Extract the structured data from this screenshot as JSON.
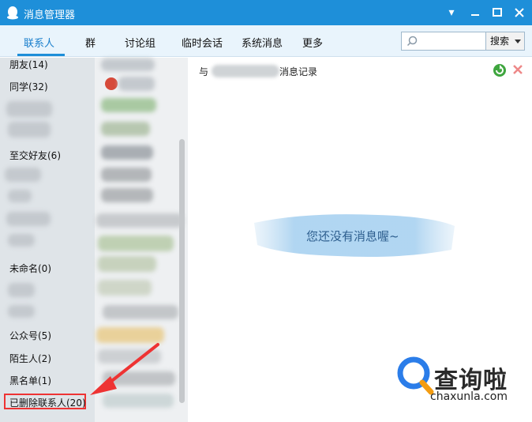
{
  "window": {
    "title": "消息管理器"
  },
  "tabs": [
    {
      "label": "联系人",
      "active": true
    },
    {
      "label": "群"
    },
    {
      "label": "讨论组"
    },
    {
      "label": "临时会话"
    },
    {
      "label": "系统消息"
    },
    {
      "label": "更多"
    }
  ],
  "search": {
    "button_label": "搜索",
    "placeholder": ""
  },
  "groups": [
    {
      "label": "朋友(14)"
    },
    {
      "label": "同学(32)"
    },
    {
      "label": "至交好友(6)"
    },
    {
      "label": "未命名(0)"
    },
    {
      "label": "公众号(5)"
    },
    {
      "label": "陌生人(2)"
    },
    {
      "label": "黑名单(1)"
    },
    {
      "label": "已删除联系人(20)",
      "highlighted": true
    }
  ],
  "main": {
    "record_prefix": "与",
    "record_suffix": "消息记录",
    "empty_text": "您还没有消息喔~"
  },
  "watermark": {
    "name": "查询啦",
    "url": "chaxunla.com"
  },
  "colors": {
    "titlebar": "#1e8fd9",
    "tabbar": "#e9f4fc",
    "highlight_border": "#ee3333",
    "empty_text": "#2e5f8f"
  }
}
